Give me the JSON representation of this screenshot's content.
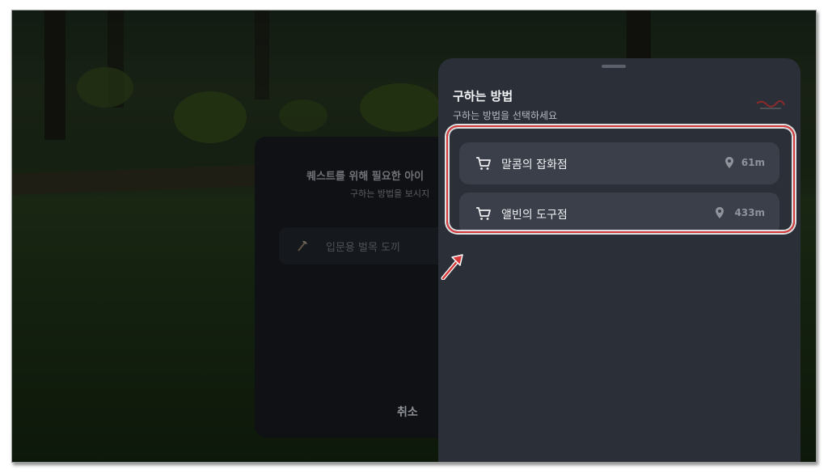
{
  "quest_dialog": {
    "title": "퀘스트를 위해 필요한 아이",
    "subtitle": "구하는 방법을 보시지",
    "item_label": "입문용 벌목 도끼",
    "item_icon": "axe-icon",
    "cancel_label": "취소"
  },
  "sheet": {
    "title": "구하는 방법",
    "subtitle": "구하는 방법을 선택하세요",
    "shops": [
      {
        "name": "말콤의 잡화점",
        "distance": "61m",
        "icon": "cart-icon",
        "location_icon": "location-pin-icon"
      },
      {
        "name": "앨빈의 도구점",
        "distance": "433m",
        "icon": "cart-icon",
        "location_icon": "location-pin-icon"
      }
    ]
  },
  "colors": {
    "annotation": "#d63a3a",
    "sheet_background": "#2b2f38",
    "item_background": "#3a3f49"
  }
}
